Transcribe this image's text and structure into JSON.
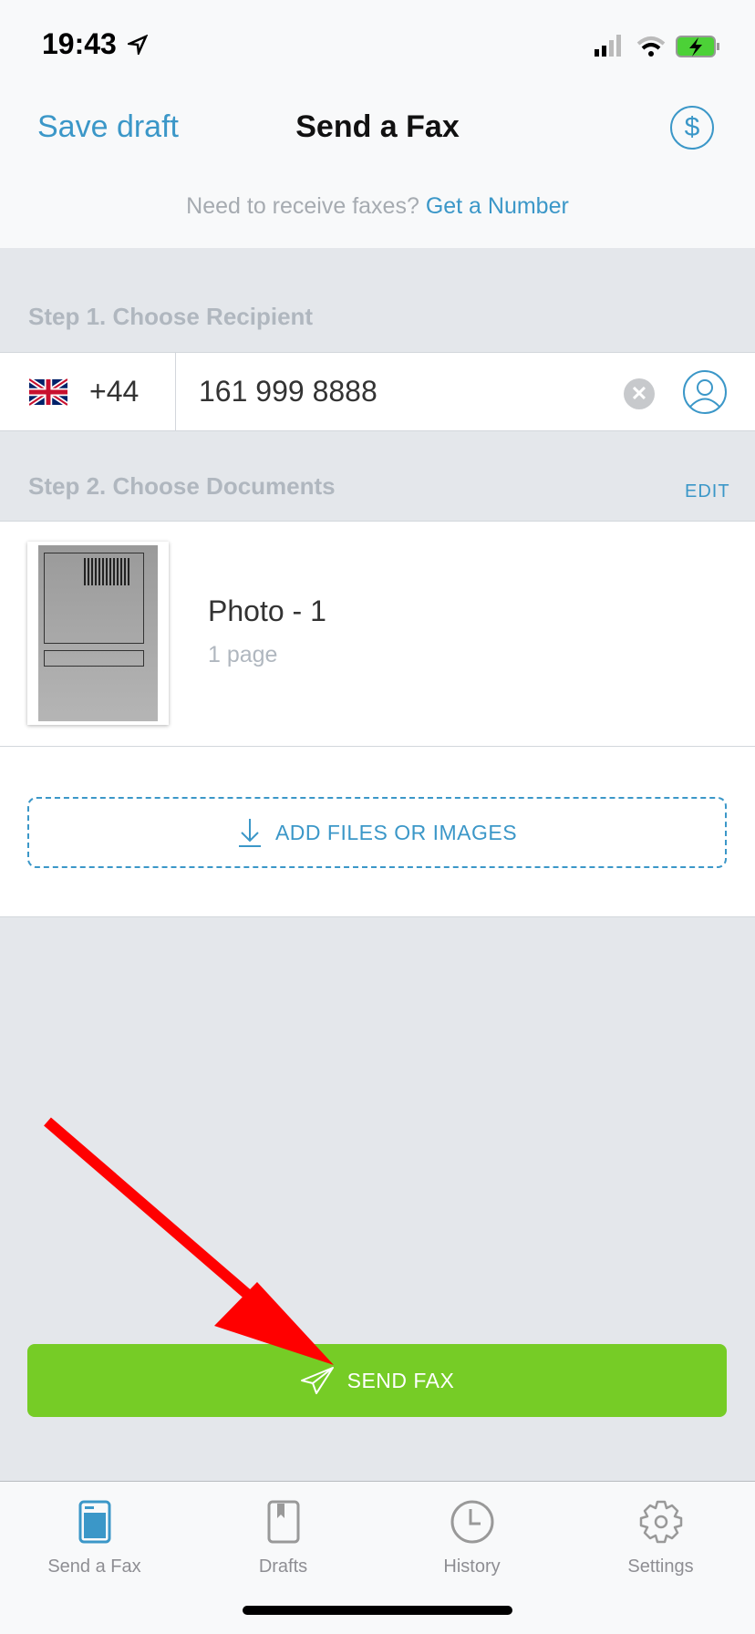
{
  "status": {
    "time": "19:43"
  },
  "nav": {
    "left": "Save draft",
    "title": "Send a Fax",
    "right_icon": "dollar-icon"
  },
  "banner": {
    "text": "Need to receive faxes?",
    "link": "Get a Number"
  },
  "step1": {
    "label": "Step 1. Choose Recipient",
    "country_code": "+44",
    "flag": "uk-flag",
    "number": "161 999 8888"
  },
  "step2": {
    "label": "Step 2. Choose Documents",
    "edit": "EDIT"
  },
  "document": {
    "name": "Photo - 1",
    "pages": "1 page"
  },
  "add_files": "ADD FILES OR IMAGES",
  "send_button": "SEND FAX",
  "tabs": [
    {
      "label": "Send a Fax",
      "active": true
    },
    {
      "label": "Drafts"
    },
    {
      "label": "History"
    },
    {
      "label": "Settings"
    }
  ],
  "colors": {
    "accent": "#3b97c8",
    "send": "#76cc26",
    "annotation_arrow": "#ff0000"
  }
}
